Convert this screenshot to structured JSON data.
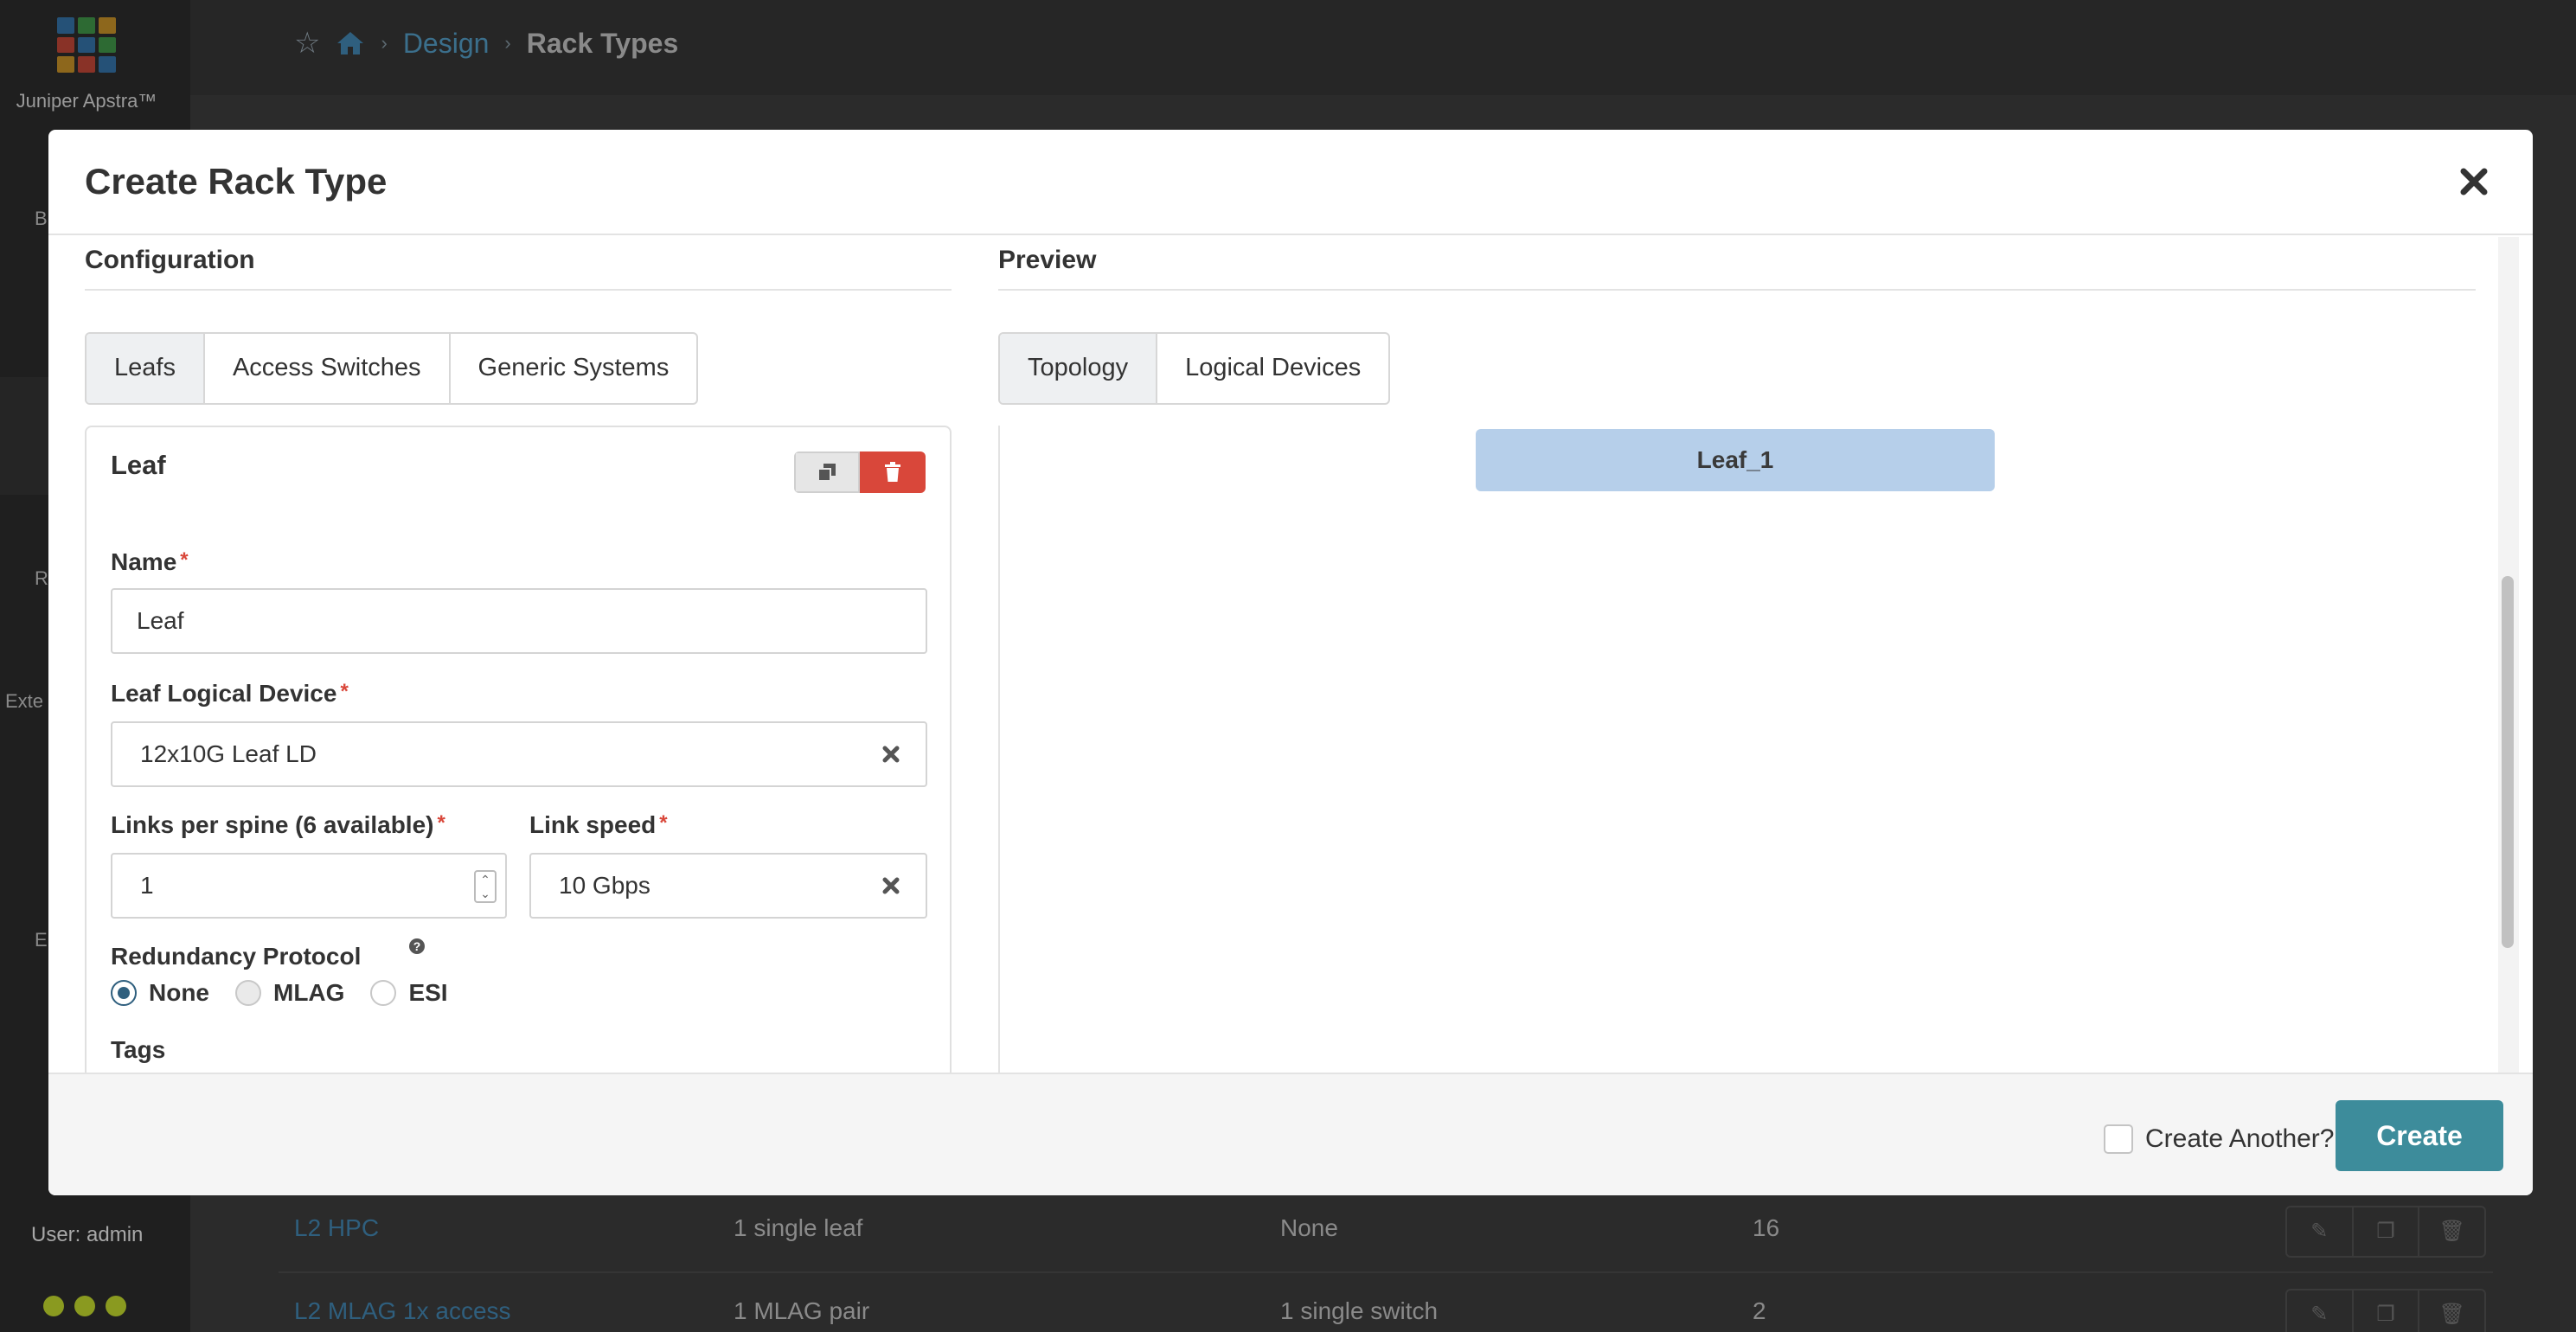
{
  "app": {
    "brand": "Juniper Apstra™",
    "user_label": "User: admin",
    "side_stubs": [
      "B",
      "R",
      "Exte",
      "E"
    ]
  },
  "breadcrumb": {
    "design": "Design",
    "current": "Rack Types"
  },
  "bg_table": {
    "rows": [
      [
        "L2 HPC",
        "1 single leaf",
        "None",
        "16"
      ],
      [
        "L2 MLAG 1x access",
        "1 MLAG pair",
        "1 single switch",
        "2"
      ]
    ]
  },
  "modal": {
    "title": "Create Rack Type",
    "configuration": {
      "title": "Configuration",
      "tabs": [
        "Leafs",
        "Access Switches",
        "Generic Systems"
      ],
      "leaf_card": {
        "title": "Leaf",
        "name_label": "Name",
        "name_value": "Leaf",
        "logical_device_label": "Leaf Logical Device",
        "logical_device_value": "12x10G Leaf LD",
        "links_label": "Links per spine (6 available)",
        "links_value": "1",
        "link_speed_label": "Link speed",
        "link_speed_value": "10 Gbps",
        "redundancy_label": "Redundancy Protocol",
        "redundancy_options": [
          "None",
          "MLAG",
          "ESI"
        ],
        "redundancy_selected": "None",
        "tags_label": "Tags"
      }
    },
    "preview": {
      "title": "Preview",
      "tabs": [
        "Topology",
        "Logical Devices"
      ],
      "nodes": [
        "Leaf_1"
      ]
    },
    "footer": {
      "create_another_label": "Create Another?",
      "create_label": "Create"
    }
  },
  "colors": {
    "primary": "#3d8c9b",
    "danger": "#d9473a",
    "link": "#2f5f7e",
    "node": "#b6cfea"
  }
}
